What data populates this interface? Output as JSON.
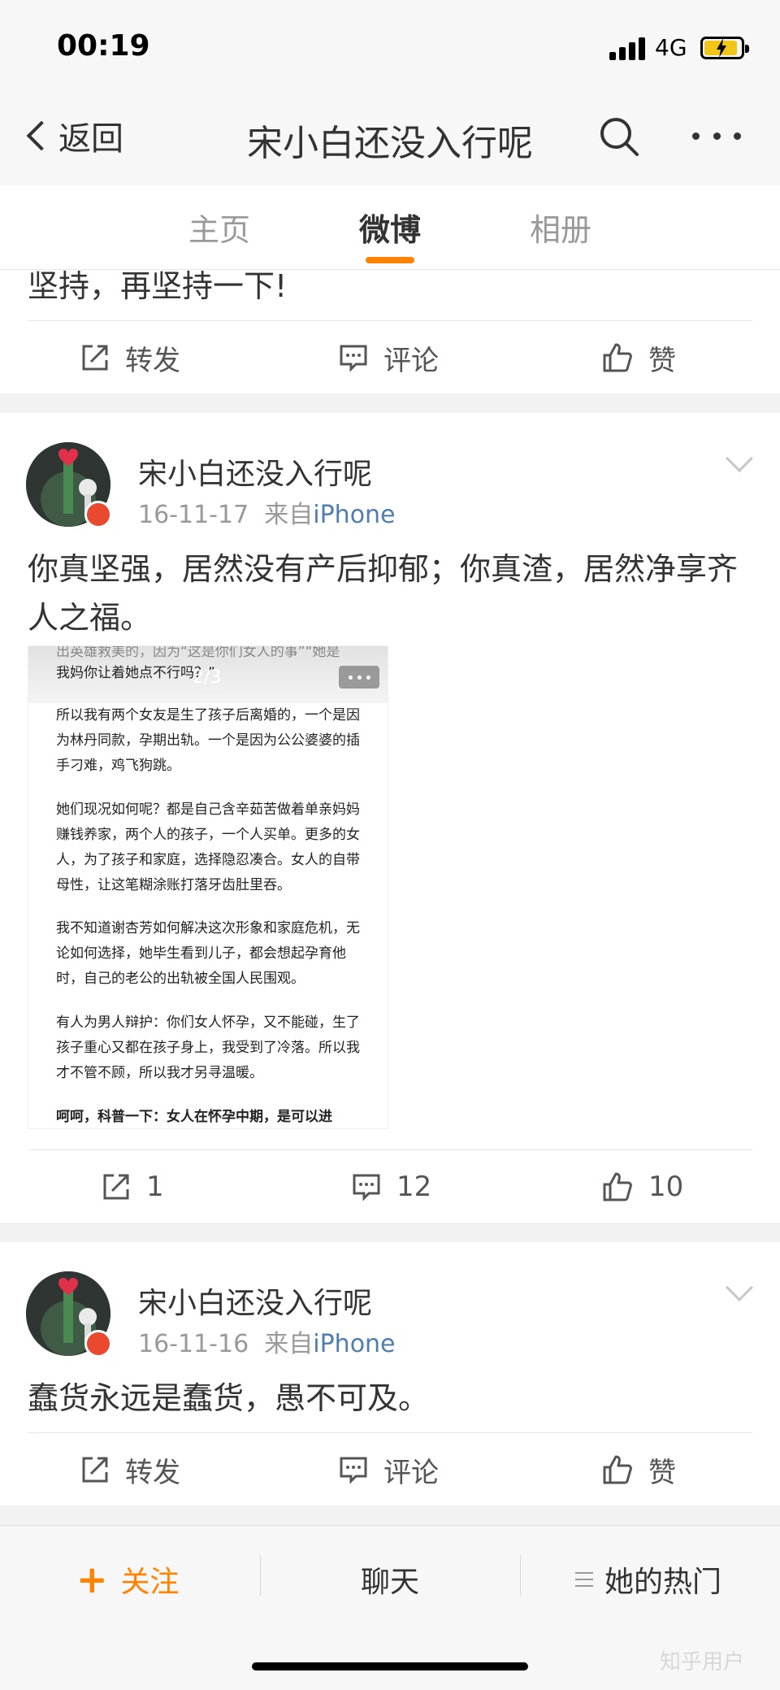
{
  "status_bar": {
    "time": "00:19",
    "network": "4G"
  },
  "nav": {
    "back_label": "返回",
    "title": "宋小白还没入行呢"
  },
  "tabs": [
    {
      "label": "主页",
      "active": false
    },
    {
      "label": "微博",
      "active": true
    },
    {
      "label": "相册",
      "active": false
    }
  ],
  "colors": {
    "accent": "#ff8200",
    "link": "#507daf"
  },
  "posts": [
    {
      "text": "坚持，再坚持一下!",
      "actions": {
        "repost": "转发",
        "comment": "评论",
        "like": "赞"
      }
    },
    {
      "author": "宋小白还没入行呢",
      "date": "16-11-17",
      "from_prefix": "来自",
      "from_source": "iPhone",
      "text_line1": "你真坚强，居然没有产后抑郁；你真渣，居然净享齐",
      "text_line2": "人之福。",
      "image": {
        "page_indicator": "2/3",
        "top_partial_line1": "出英雄救美的，因为“这是你们女人的事”“她是",
        "top_partial_line2": "我妈你让着她点不行吗？”",
        "paragraphs": [
          "所以我有两个女友是生了孩子后离婚的，一个是因为林丹同款，孕期出轨。一个是因为公公婆婆的插手刁难，鸡飞狗跳。",
          "她们现况如何呢？都是自己含辛茹苦做着单亲妈妈赚钱养家，两个人的孩子，一个人买单。更多的女人，为了孩子和家庭，选择隐忍凑合。女人的自带母性，让这笔糊涂账打落牙齿肚里吞。",
          "我不知道谢杏芳如何解决这次形象和家庭危机，无论如何选择，她毕生看到儿子，都会想起孕育他时，自己的老公的出轨被全国人民围观。",
          "有人为男人辩护：你们女人怀孕，又不能碰，生了孩子重心又都在孩子身上，我受到了冷落。所以我才不管不顾，所以我才另寻温暖。",
          "呵呵，科普一下：女人在怀孕中期，是可以进"
        ]
      },
      "actions": {
        "repost": "1",
        "comment": "12",
        "like": "10"
      }
    },
    {
      "author": "宋小白还没入行呢",
      "date": "16-11-16",
      "from_prefix": "来自",
      "from_source": "iPhone",
      "text": "蠢货永远是蠢货，愚不可及。",
      "actions": {
        "repost": "转发",
        "comment": "评论",
        "like": "赞"
      }
    }
  ],
  "bottom_bar": {
    "follow_plus": "+",
    "follow": "关注",
    "chat": "聊天",
    "hot": "她的热门"
  },
  "watermark": "知乎用户"
}
